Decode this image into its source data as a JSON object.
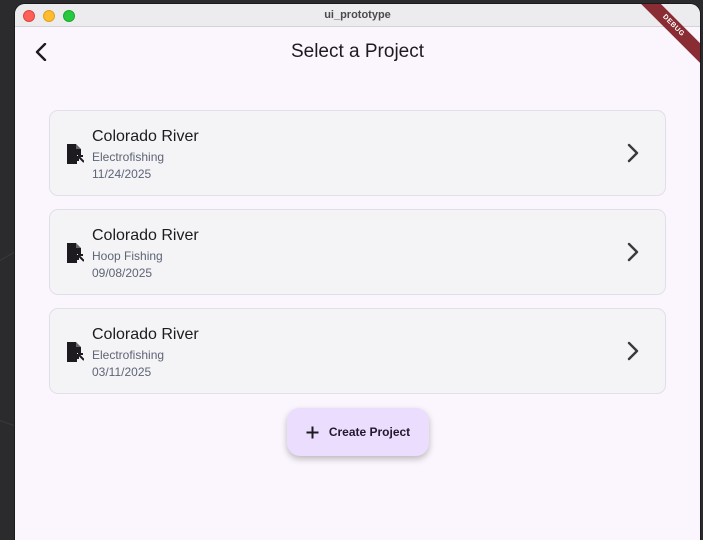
{
  "window": {
    "title": "ui_prototype"
  },
  "appbar": {
    "title": "Select a Project",
    "back_icon": "chevron-left-icon"
  },
  "debug_banner": "DEBUG",
  "projects": [
    {
      "name": "Colorado River",
      "method": "Electrofishing",
      "date": "11/24/2025"
    },
    {
      "name": "Colorado River",
      "method": "Hoop Fishing",
      "date": "09/08/2025"
    },
    {
      "name": "Colorado River",
      "method": "Electrofishing",
      "date": "03/11/2025"
    }
  ],
  "actions": {
    "create_label": "Create Project",
    "create_icon": "plus-icon"
  },
  "colors": {
    "background": "#fbf6fd",
    "card": "#f4f3f5",
    "fab": "#eaddfe",
    "debug_ribbon": "#8a2c33"
  }
}
